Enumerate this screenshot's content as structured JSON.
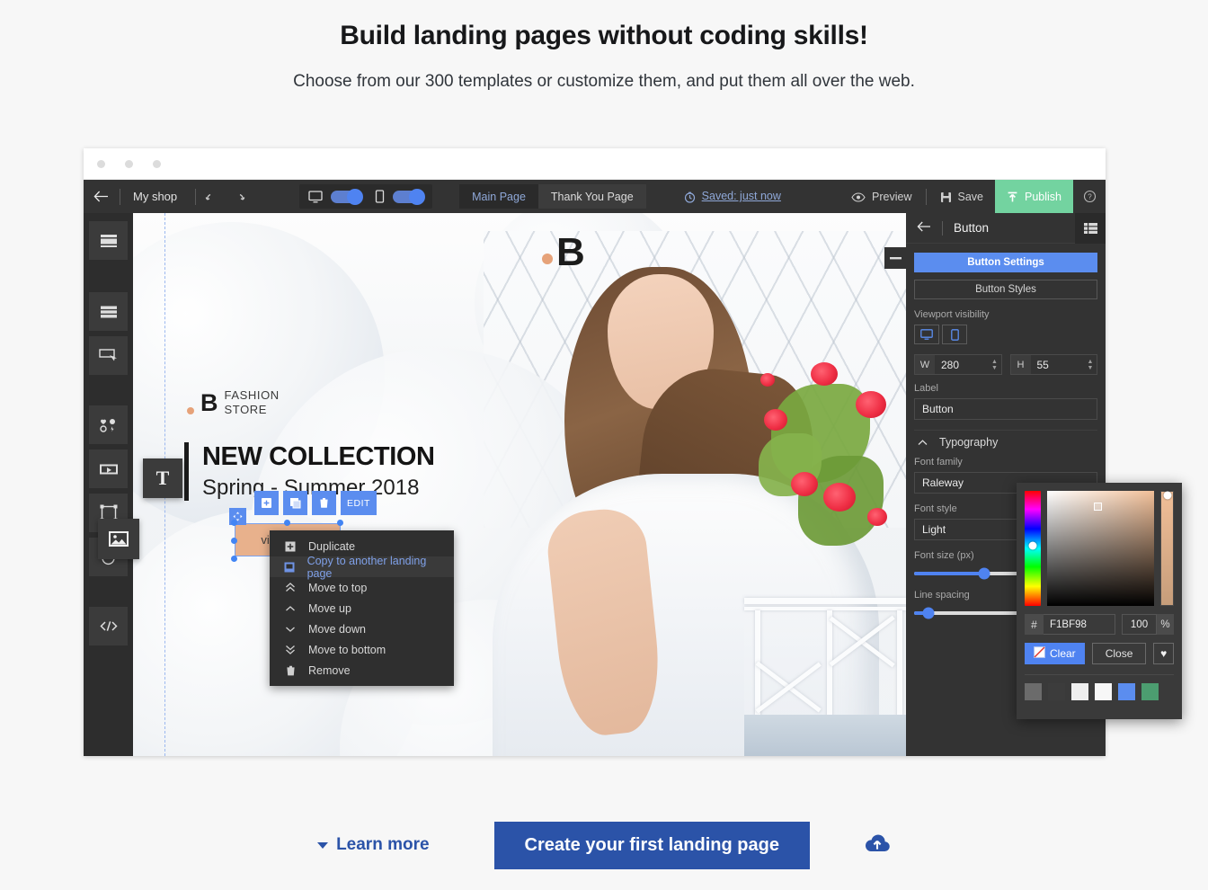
{
  "page": {
    "title": "Build landing pages without coding skills!",
    "subtitle": "Choose from our 300 templates or customize them, and put them all over the web."
  },
  "footer": {
    "learn_more": "Learn more",
    "cta": "Create your first landing page",
    "upload_icon": "cloud-upload-icon"
  },
  "editor": {
    "toolbar": {
      "back_icon": "arrow-left-icon",
      "project_name": "My shop",
      "undo_icon": "undo-icon",
      "redo_icon": "redo-icon",
      "desktop_icon": "desktop-icon",
      "desktop_toggle": "on",
      "mobile_icon": "mobile-icon",
      "mobile_toggle": "on",
      "pages": [
        {
          "label": "Main Page",
          "active": true
        },
        {
          "label": "Thank You Page",
          "active": false
        }
      ],
      "saved_icon": "history-icon",
      "saved_label": "Saved: just now",
      "preview_icon": "eye-icon",
      "preview_label": "Preview",
      "save_icon": "floppy-icon",
      "save_label": "Save",
      "publish_icon": "publish-upload-icon",
      "publish_label": "Publish",
      "help_icon": "help-circle-icon"
    },
    "rail": [
      {
        "name": "template-icon"
      },
      {
        "name": "sections-icon"
      },
      {
        "name": "button-icon"
      },
      {
        "name": "social-icons-icon"
      },
      {
        "name": "video-icon"
      },
      {
        "name": "shape-icon"
      },
      {
        "name": "timer-icon"
      },
      {
        "name": "code-icon"
      }
    ],
    "tiles": [
      {
        "name": "text-tile",
        "glyph": "T"
      },
      {
        "name": "image-tile",
        "glyph": "image-icon"
      }
    ],
    "canvas": {
      "logo_letter": "B",
      "brand_letter": "B",
      "brand_line1": "FASHION",
      "brand_line2": "STORE",
      "headline": "NEW COLLECTION",
      "subheadline": "Spring - Summer 2018",
      "cta_label": "view more",
      "selection_tools": [
        {
          "name": "duplicate-icon",
          "label": ""
        },
        {
          "name": "copy-icon",
          "label": ""
        },
        {
          "name": "trash-icon",
          "label": ""
        },
        {
          "name": "edit-button",
          "label": "EDIT"
        }
      ]
    },
    "context_menu": [
      {
        "label": "Duplicate",
        "icon": "duplicate-icon",
        "highlighted": false
      },
      {
        "label": "Copy to another landing page",
        "icon": "copy-page-icon",
        "highlighted": true
      },
      {
        "label": "Move to top",
        "icon": "double-chevron-up-icon",
        "highlighted": false
      },
      {
        "label": "Move up",
        "icon": "chevron-up-icon",
        "highlighted": false
      },
      {
        "label": "Move down",
        "icon": "chevron-down-icon",
        "highlighted": false
      },
      {
        "label": "Move to bottom",
        "icon": "double-chevron-down-icon",
        "highlighted": false
      },
      {
        "label": "Remove",
        "icon": "trash-icon",
        "highlighted": false
      }
    ],
    "panel": {
      "back_icon": "arrow-left-icon",
      "title": "Button",
      "menu_icon": "list-menu-icon",
      "collapse_icon": "minimize-icon",
      "tab_settings": "Button Settings",
      "tab_styles": "Button Styles",
      "viewport_label": "Viewport visibility",
      "viewport_desktop_icon": "desktop-icon",
      "viewport_mobile_icon": "mobile-icon",
      "width_key": "W",
      "width_value": "280",
      "height_key": "H",
      "height_value": "55",
      "label_label": "Label",
      "label_value": "Button",
      "typography_label": "Typography",
      "font_family_label": "Font family",
      "font_family_value": "Raleway",
      "font_style_label": "Font style",
      "font_style_value": "Light",
      "font_size_label": "Font size (px)",
      "font_size_pct": 38,
      "line_spacing_label": "Line spacing",
      "line_spacing_pct": 8
    },
    "color_picker": {
      "hex_key": "#",
      "hex_value": "F1BF98",
      "opacity_value": "100",
      "opacity_unit": "%",
      "clear_label": "Clear",
      "clear_icon": "no-color-icon",
      "close_label": "Close",
      "favorite_icon": "heart-icon",
      "swatches": [
        "#6b6b6b",
        "#3c3c3c",
        "#efefef",
        "#f7f7f7",
        "#5b8def",
        "#4c9d70"
      ]
    }
  },
  "colors": {
    "accent_blue": "#2b53a8",
    "editor_blue": "#5b8def",
    "publish_green": "#73d3a0",
    "picked_color": "#F1BF98"
  }
}
